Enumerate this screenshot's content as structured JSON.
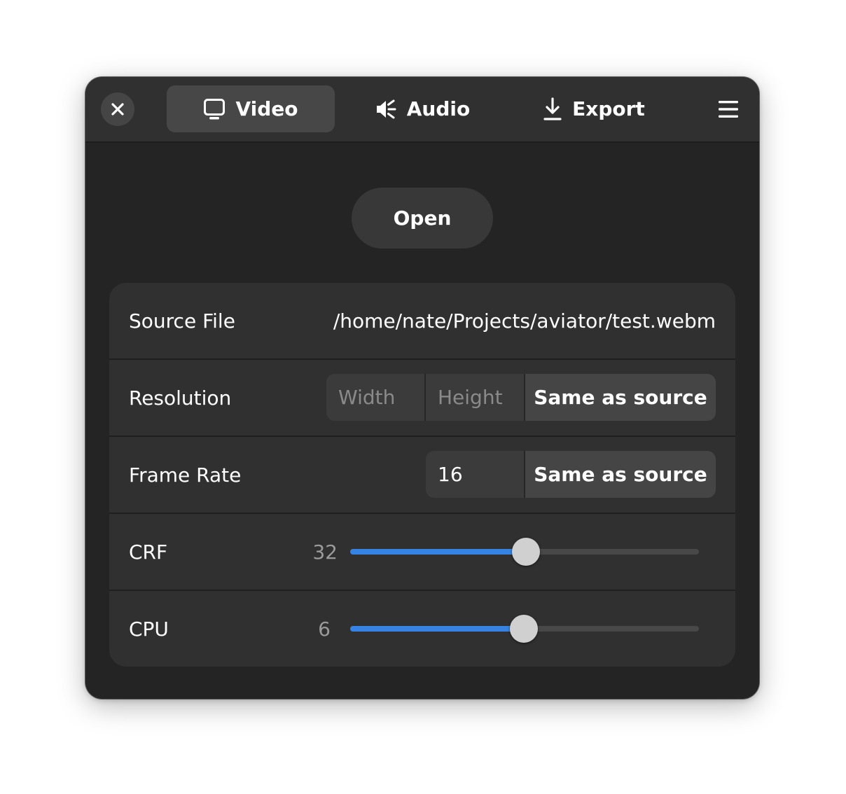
{
  "header": {
    "tabs": [
      {
        "label": "Video",
        "icon": "monitor-icon",
        "active": true
      },
      {
        "label": "Audio",
        "icon": "speaker-icon",
        "active": false
      },
      {
        "label": "Export",
        "icon": "download-icon",
        "active": false
      }
    ],
    "close_icon": "close-icon",
    "menu_icon": "hamburger-menu-icon"
  },
  "main": {
    "open_label": "Open",
    "rows": {
      "source": {
        "title": "Source File",
        "value": "/home/nate/Projects/aviator/test.webm"
      },
      "resolution": {
        "title": "Resolution",
        "width_placeholder": "Width",
        "height_placeholder": "Height",
        "button": "Same as source"
      },
      "framerate": {
        "title": "Frame Rate",
        "value": "16",
        "button": "Same as source"
      },
      "crf": {
        "title": "CRF",
        "value": "32",
        "fraction": 0.505
      },
      "cpu": {
        "title": "CPU",
        "value": "6",
        "fraction": 0.497
      }
    }
  },
  "colors": {
    "accent": "#3584e4",
    "window_bg": "#242424",
    "card_bg": "#303030"
  }
}
